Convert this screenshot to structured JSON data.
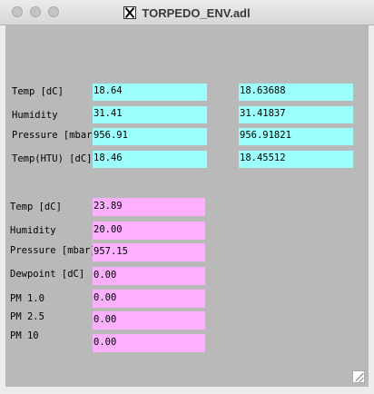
{
  "window": {
    "title": "TORPEDO_ENV.adl"
  },
  "section1": {
    "rows": [
      {
        "label": "Temp [dC]",
        "value": "18.64",
        "raw": "18.63688"
      },
      {
        "label": "Humidity",
        "value": "31.41",
        "raw": "31.41837"
      },
      {
        "label": "Pressure [mbar]",
        "value": "956.91",
        "raw": "956.91821"
      },
      {
        "label": "Temp(HTU) [dC]",
        "value": "18.46",
        "raw": "18.45512"
      }
    ]
  },
  "section2": {
    "rows": [
      {
        "label": "Temp [dC]",
        "value": "23.89"
      },
      {
        "label": "Humidity",
        "value": "20.00"
      },
      {
        "label": "Pressure [mbar]",
        "value": "957.15"
      },
      {
        "label": "Dewpoint [dC]",
        "value": "0.00"
      },
      {
        "label": "PM 1.0",
        "value": "0.00"
      },
      {
        "label": "PM 2.5",
        "value": "0.00"
      },
      {
        "label": "PM 10",
        "value": "0.00"
      }
    ]
  },
  "colors": {
    "cyan_field": "#9cfffc",
    "pink_field": "#fcb0ff",
    "canvas_bg": "#b9b9b9"
  },
  "icons": [
    "close-button-icon",
    "minimize-button-icon",
    "zoom-button-icon",
    "x11-app-icon",
    "resize-grip-icon"
  ]
}
